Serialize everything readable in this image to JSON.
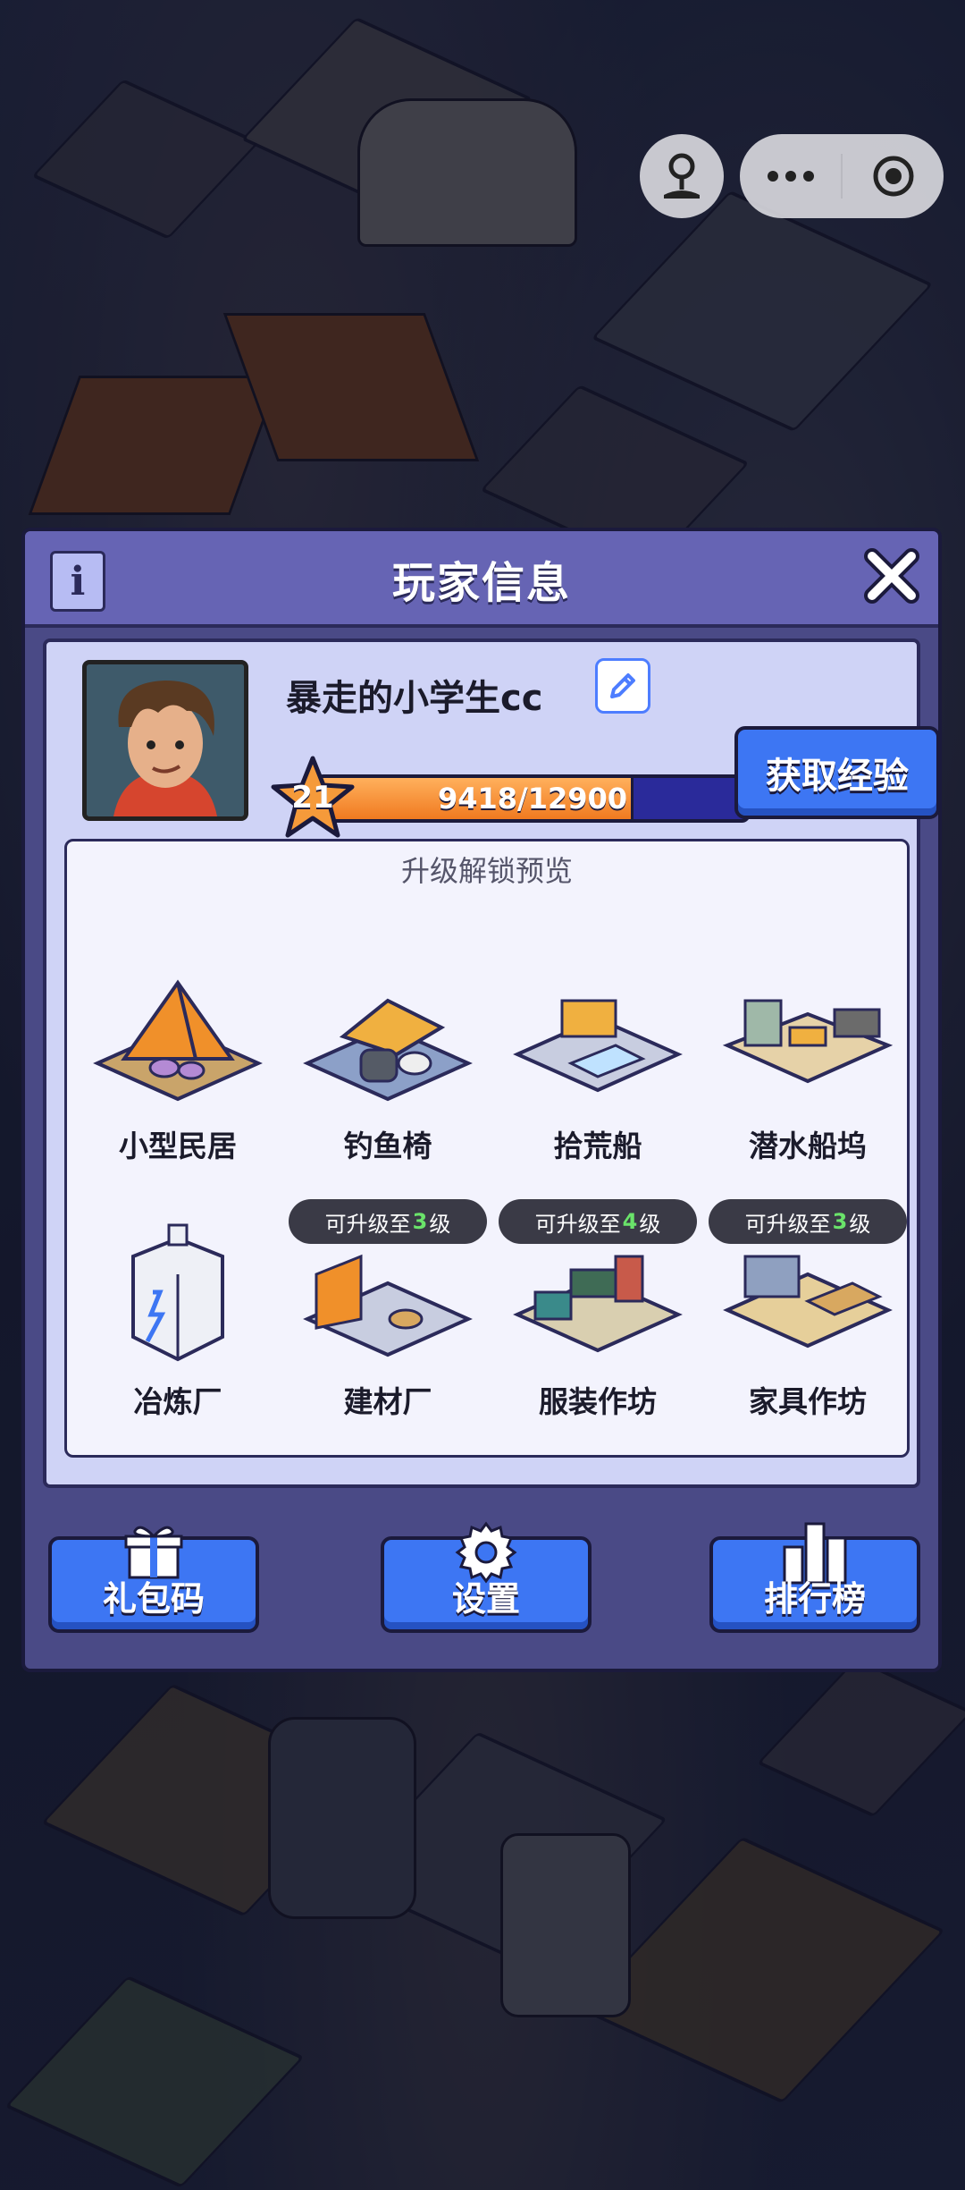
{
  "dialog": {
    "title": "玩家信息",
    "info_icon": "info-icon",
    "close_icon": "close-icon"
  },
  "player": {
    "name": "暴走的小学生cc",
    "level": "21",
    "xp_text": "9418/12900",
    "xp_current": 9418,
    "xp_max": 12900,
    "get_exp_label": "获取经验"
  },
  "preview": {
    "title": "升级解锁预览",
    "items": [
      {
        "label": "小型民居",
        "badge": null
      },
      {
        "label": "钓鱼椅",
        "badge": null
      },
      {
        "label": "拾荒船",
        "badge": null
      },
      {
        "label": "潜水船坞",
        "badge": null
      },
      {
        "label": "冶炼厂",
        "badge": null
      },
      {
        "label": "建材厂",
        "badge_prefix": "可升级至",
        "badge_level": "3",
        "badge_suffix": "级"
      },
      {
        "label": "服装作坊",
        "badge_prefix": "可升级至",
        "badge_level": "4",
        "badge_suffix": "级"
      },
      {
        "label": "家具作坊",
        "badge_prefix": "可升级至",
        "badge_level": "3",
        "badge_suffix": "级"
      }
    ]
  },
  "footer": {
    "gift_label": "礼包码",
    "settings_label": "设置",
    "rank_label": "排行榜"
  },
  "colors": {
    "header": "#6664b4",
    "dialog": "#4a4a86",
    "panel": "#cfd3f6",
    "button": "#3d76f3",
    "xp_fill": "#f07a20",
    "badge_level": "#6ae36a"
  }
}
